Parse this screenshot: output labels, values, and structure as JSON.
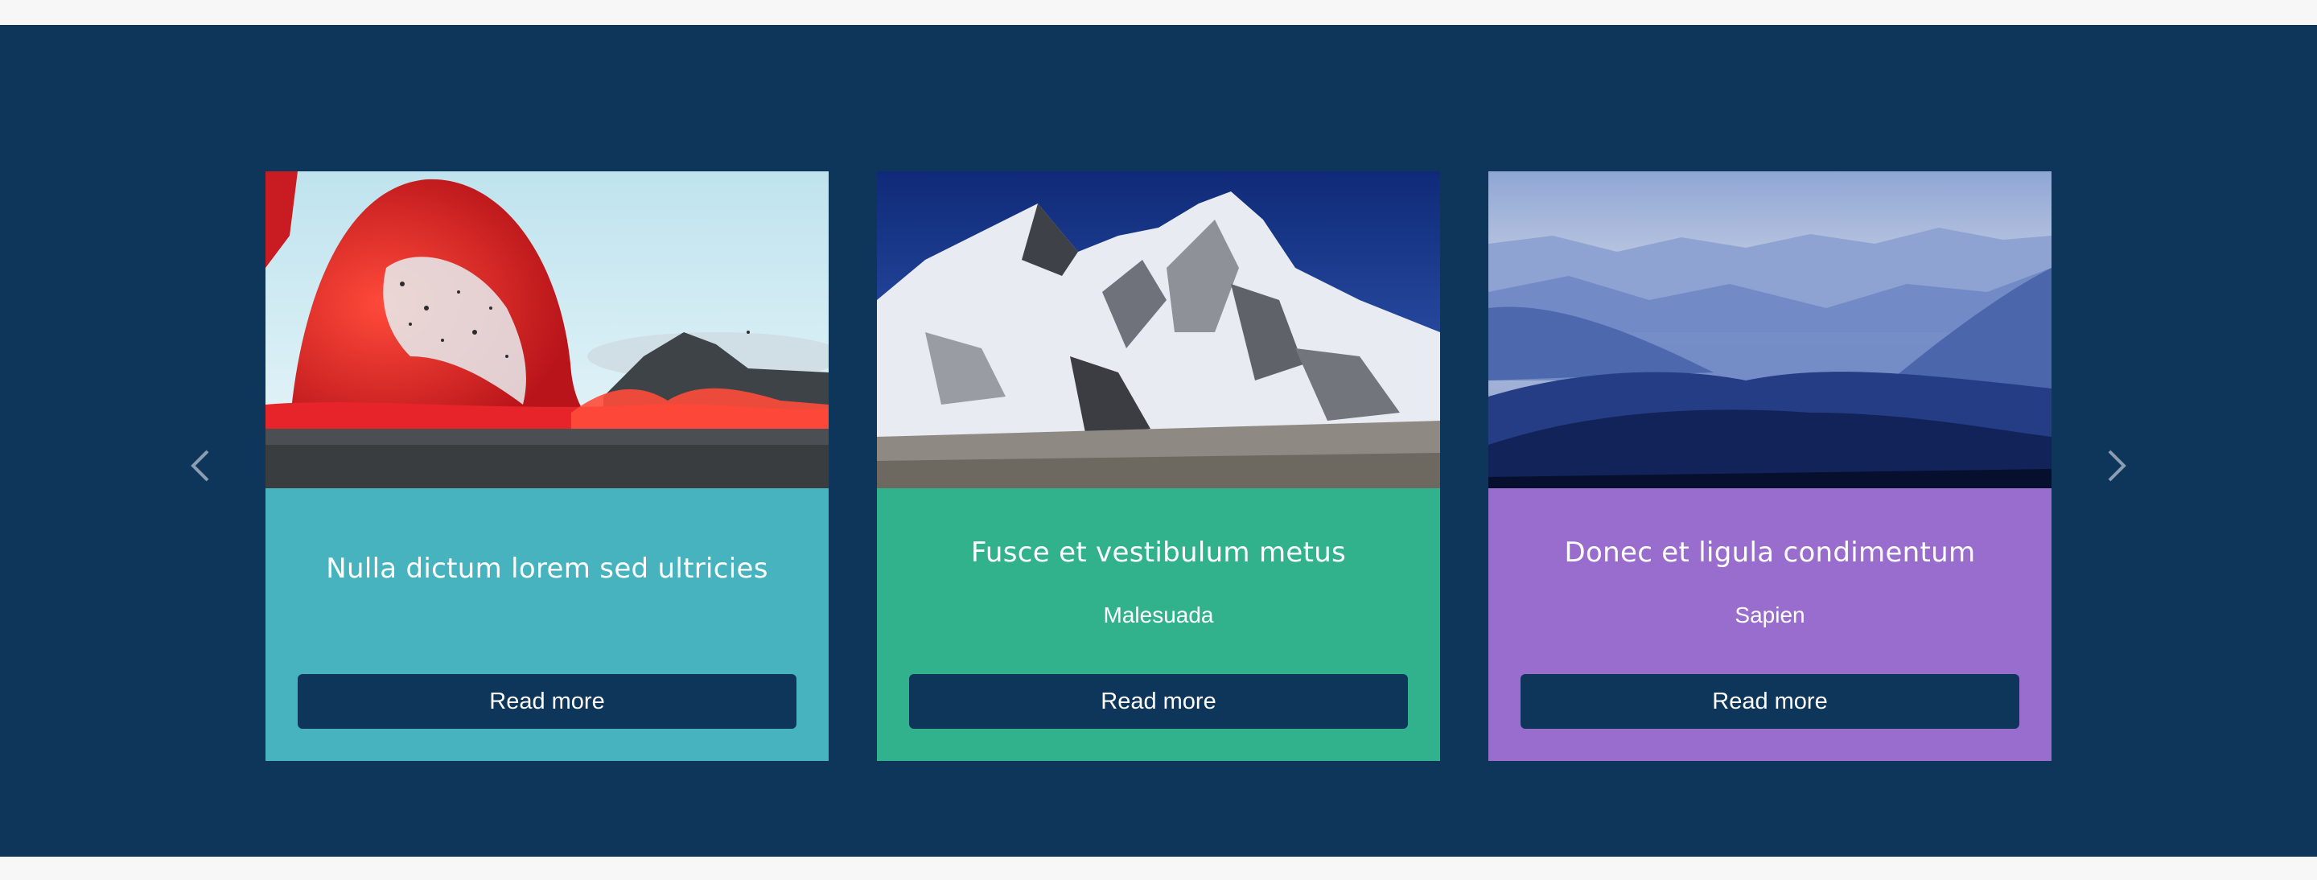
{
  "carousel": {
    "prev_icon": "chevron-left-icon",
    "next_icon": "chevron-right-icon",
    "band_color": "#0d365a",
    "cards": [
      {
        "title": "Nulla dictum lorem sed ultricies",
        "subtitle": "",
        "button_label": "Read more",
        "color": "#47b3bf",
        "image": "volcano-lava-photo"
      },
      {
        "title": "Fusce et vestibulum metus",
        "subtitle": "Malesuada",
        "button_label": "Read more",
        "color": "#31b28c",
        "image": "snowy-mountain-photo"
      },
      {
        "title": "Donec et ligula condimentum",
        "subtitle": "Sapien",
        "button_label": "Read more",
        "color": "#996dcd",
        "image": "misty-blue-mountains-photo"
      }
    ]
  }
}
